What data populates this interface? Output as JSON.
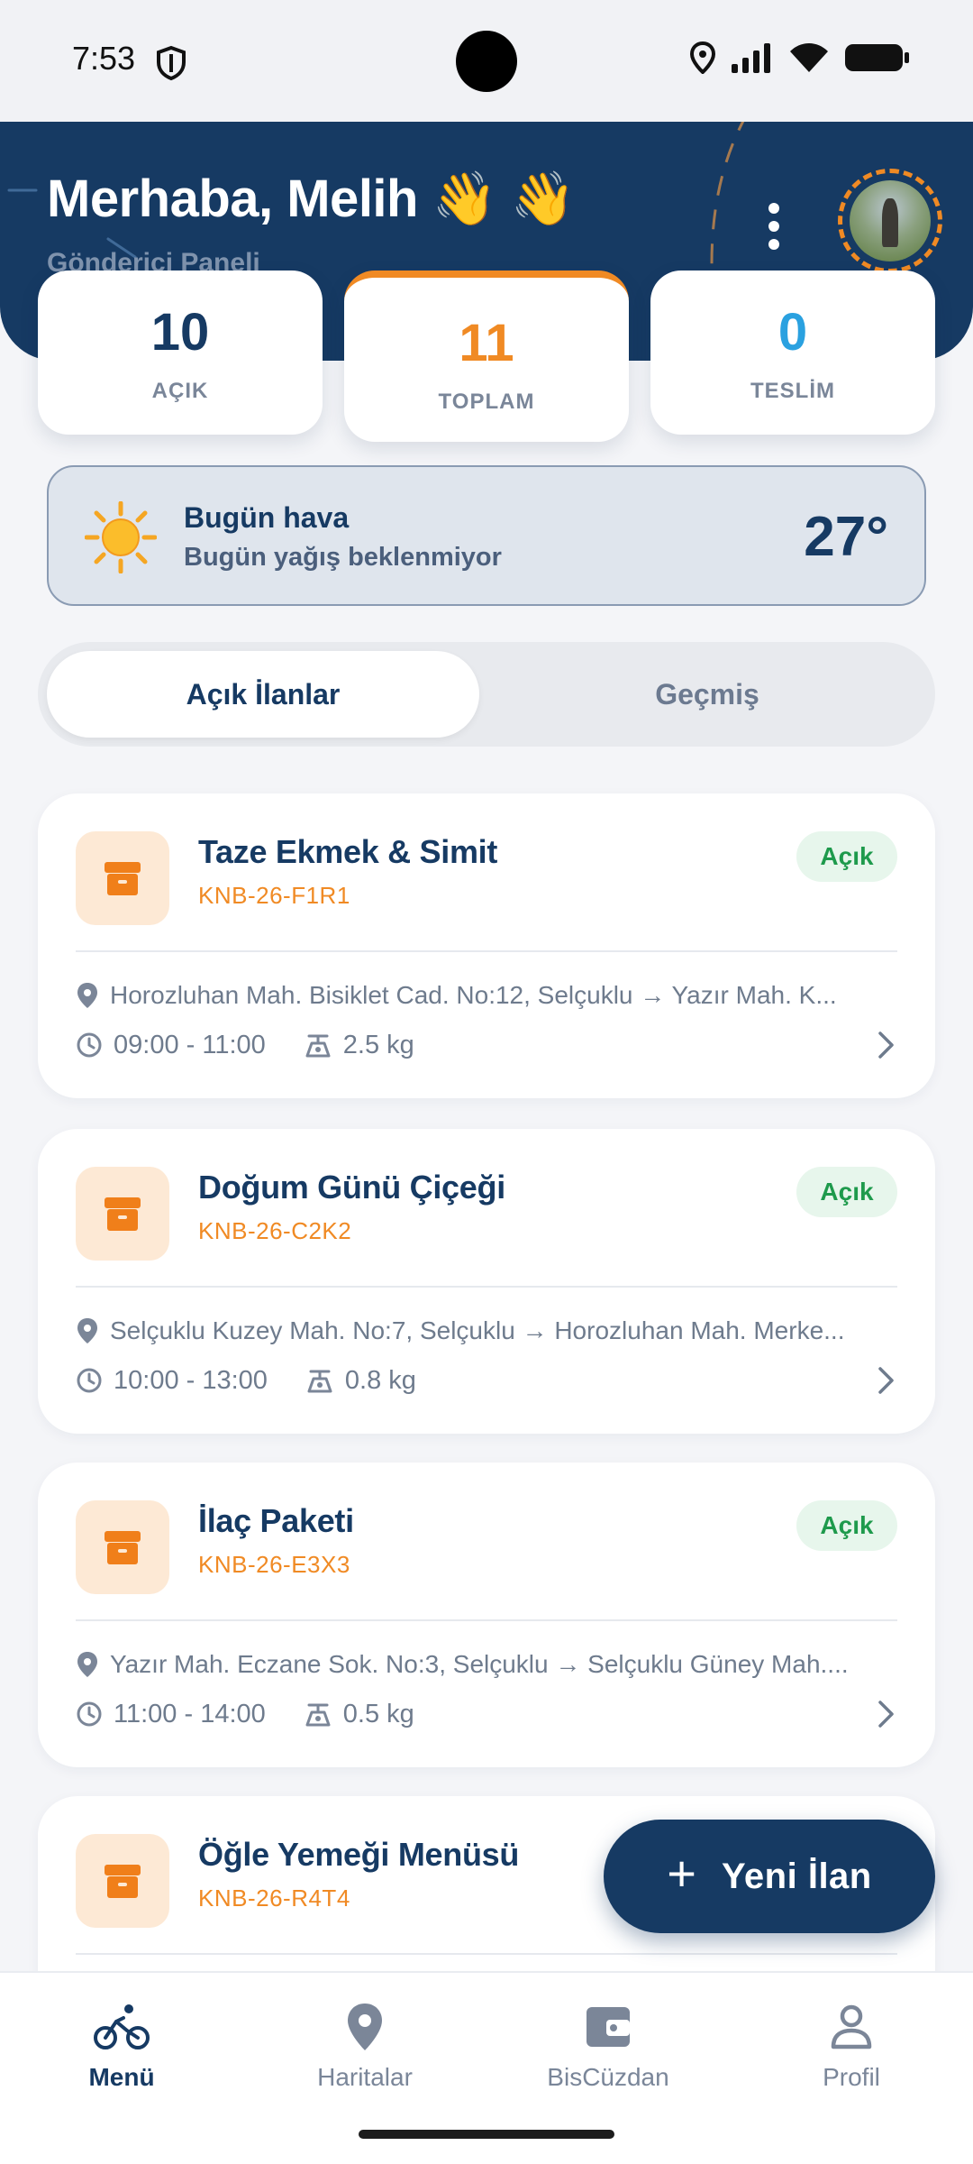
{
  "status_bar": {
    "time": "7:53"
  },
  "header": {
    "greeting": "Merhaba, Melih 👋 👋",
    "subtitle": "Gönderici Paneli"
  },
  "stats": {
    "open": {
      "value": "10",
      "label": "AÇIK",
      "color": "#163a63"
    },
    "total": {
      "value": "11",
      "label": "TOPLAM",
      "color": "#f08a24"
    },
    "delivered": {
      "value": "0",
      "label": "TESLİM",
      "color": "#2aa1e0"
    }
  },
  "weather": {
    "title": "Bugün hava",
    "description": "Bugün yağış beklenmiyor",
    "temperature": "27°",
    "icon": "sun-icon"
  },
  "tabs": [
    {
      "label": "Açık İlanlar",
      "active": true
    },
    {
      "label": "Geçmiş",
      "active": false
    }
  ],
  "listings": [
    {
      "title": "Taze Ekmek & Simit",
      "code": "KNB-26-F1R1",
      "status": "Açık",
      "route": "Horozluhan Mah. Bisiklet Cad. No:12, Selçuklu → Yazır Mah. K...",
      "time": "09:00 - 11:00",
      "weight": "2.5 kg"
    },
    {
      "title": "Doğum Günü Çiçeği",
      "code": "KNB-26-C2K2",
      "status": "Açık",
      "route": "Selçuklu Kuzey Mah. No:7, Selçuklu → Horozluhan Mah. Merke...",
      "time": "10:00 - 13:00",
      "weight": "0.8 kg"
    },
    {
      "title": "İlaç Paketi",
      "code": "KNB-26-E3X3",
      "status": "Açık",
      "route": "Yazır Mah. Eczane Sok. No:3, Selçuklu → Selçuklu Güney Mah....",
      "time": "11:00 - 14:00",
      "weight": "0.5 kg"
    },
    {
      "title": "Öğle Yemeği Menüsü",
      "code": "KNB-26-R4T4",
      "status": "",
      "route": "",
      "time": "",
      "weight": ""
    }
  ],
  "fab": {
    "label": "Yeni İlan"
  },
  "bottom_nav": [
    {
      "label": "Menü",
      "icon": "bike-icon",
      "active": true
    },
    {
      "label": "Haritalar",
      "icon": "map-pin-icon",
      "active": false
    },
    {
      "label": "BisCüzdan",
      "icon": "wallet-icon",
      "active": false
    },
    {
      "label": "Profil",
      "icon": "profile-icon",
      "active": false
    }
  ],
  "colors": {
    "primary": "#163a63",
    "accent": "#f08a24",
    "success": "#1e9a4c",
    "info": "#2aa1e0"
  }
}
